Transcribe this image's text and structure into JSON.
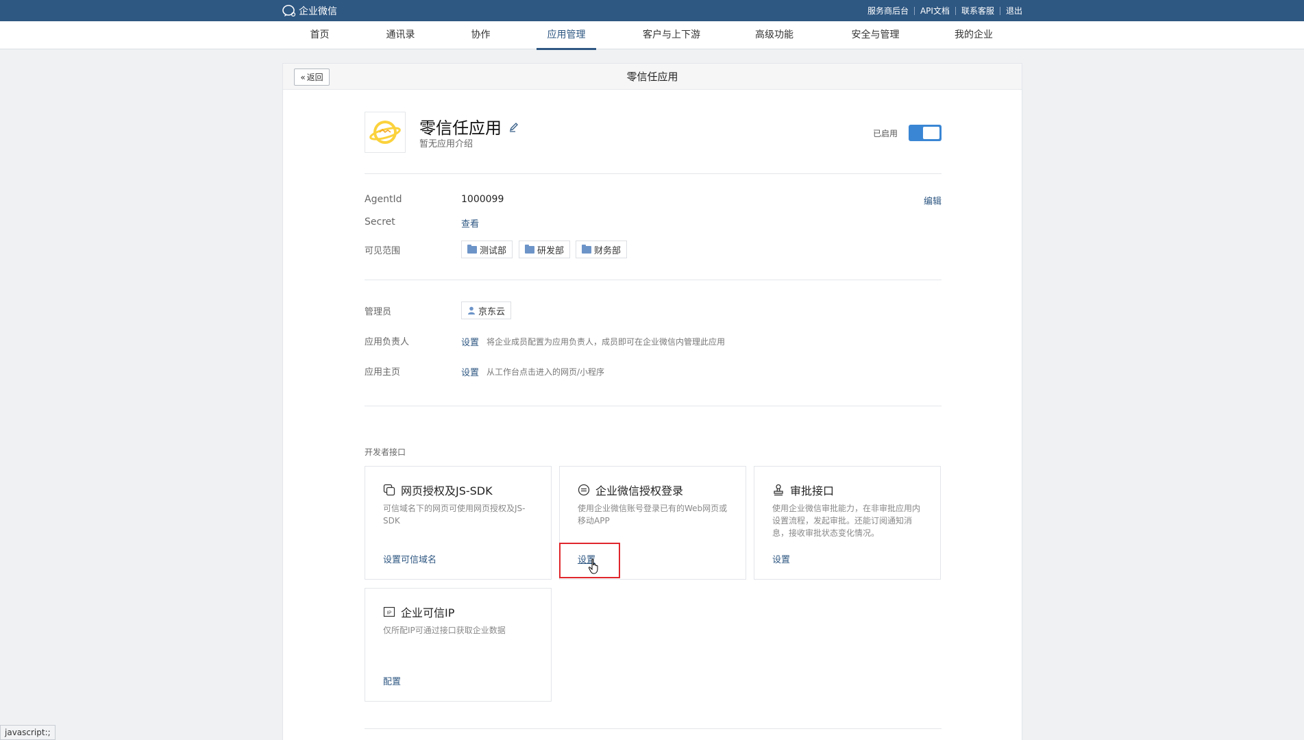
{
  "topbar": {
    "brand": "企业微信",
    "links": [
      "服务商后台",
      "API文档",
      "联系客服",
      "退出"
    ]
  },
  "nav": {
    "items": [
      "首页",
      "通讯录",
      "协作",
      "应用管理",
      "客户与上下游",
      "高级功能",
      "安全与管理",
      "我的企业"
    ],
    "active": "应用管理"
  },
  "panel": {
    "back_label": "返回",
    "title": "零信任应用"
  },
  "app": {
    "name": "零信任应用",
    "description": "暂无应用介绍",
    "status_label": "已启用",
    "enabled": true
  },
  "info": {
    "agentid_label": "AgentId",
    "agentid_value": "1000099",
    "edit_label": "编辑",
    "secret_label": "Secret",
    "secret_action": "查看",
    "scope_label": "可见范围",
    "scope_tags": [
      "测试部",
      "研发部",
      "财务部"
    ]
  },
  "admin": {
    "admin_label": "管理员",
    "admin_name": "京东云",
    "owner_label": "应用负责人",
    "owner_action": "设置",
    "owner_hint": "将企业成员配置为应用负责人，成员即可在企业微信内管理此应用",
    "homepage_label": "应用主页",
    "homepage_action": "设置",
    "homepage_hint": "从工作台点击进入的网页/小程序"
  },
  "dev": {
    "section_label": "开发者接口",
    "cards": [
      {
        "title": "网页授权及JS-SDK",
        "desc": "可信域名下的网页可使用网页授权及JS-SDK",
        "action": "设置可信域名",
        "icon": "webpage-auth-icon"
      },
      {
        "title": "企业微信授权登录",
        "desc": "使用企业微信账号登录已有的Web网页或移动APP",
        "action": "设置",
        "icon": "auth-login-icon"
      },
      {
        "title": "审批接口",
        "desc": "使用企业微信审批能力，在非审批应用内设置流程，发起审批。还能订阅通知消息，接收审批状态变化情况。",
        "action": "设置",
        "icon": "approval-stamp-icon"
      },
      {
        "title": "企业可信IP",
        "desc": "仅所配IP可通过接口获取企业数据",
        "action": "配置",
        "icon": "ip-icon"
      }
    ]
  },
  "statusbar": {
    "text": "javascript:;"
  },
  "colors": {
    "topbar": "#2e5782",
    "link": "#2e5782",
    "toggle": "#3a86d4",
    "highlight": "#e0262c"
  }
}
